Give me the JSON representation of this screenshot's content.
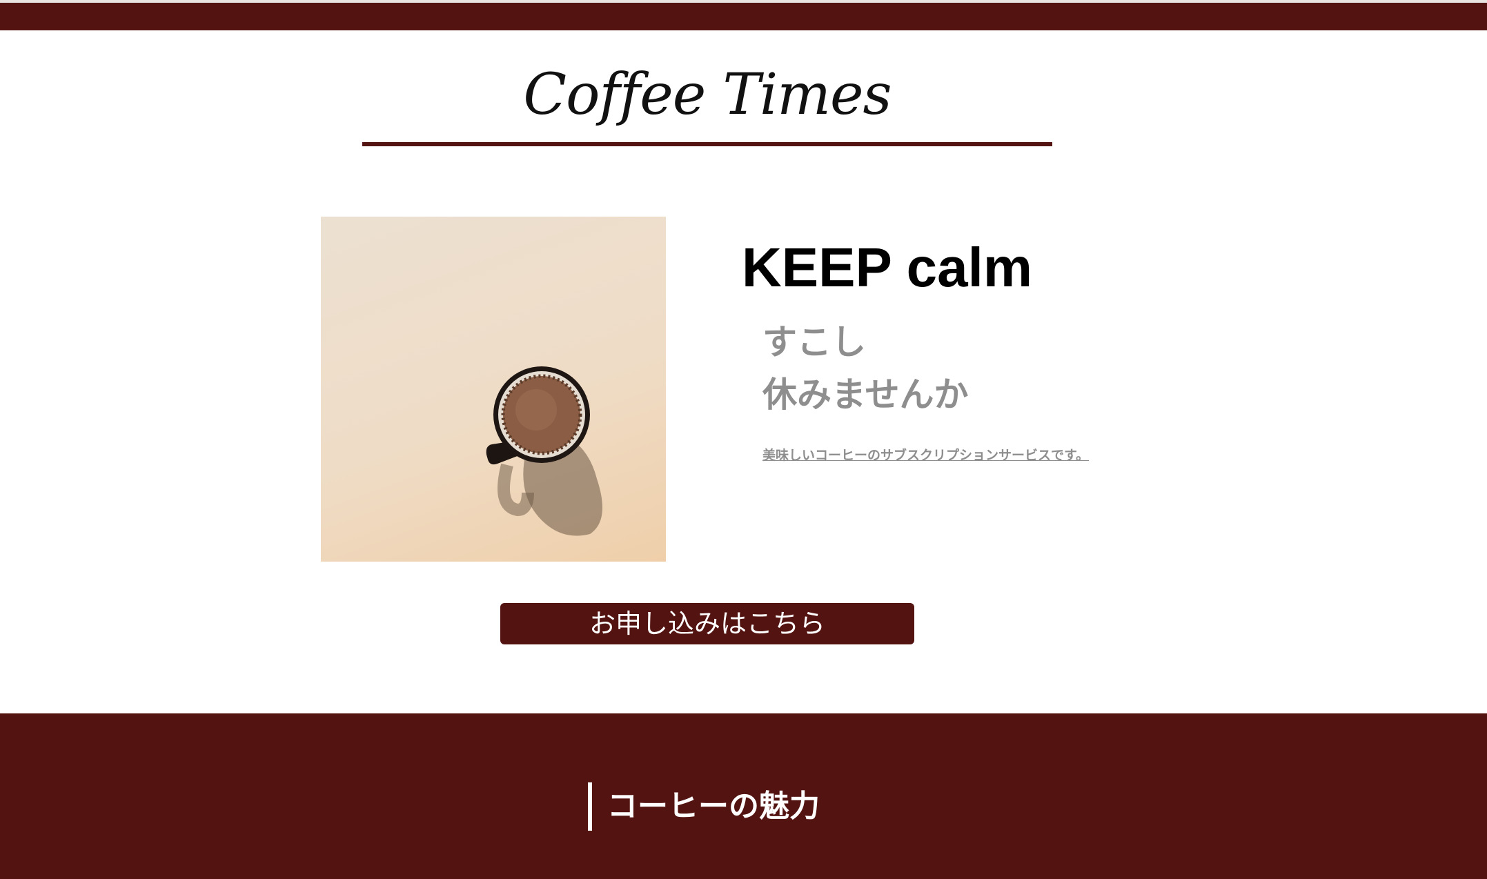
{
  "header": {
    "site_title": "Coffee Times"
  },
  "hero": {
    "image_alt": "coffee-mug-top-view",
    "headline": "KEEP calm",
    "subline_1": "すこし",
    "subline_2": "休みませんか",
    "description": "美味しいコーヒーのサブスクリプションサービスです。"
  },
  "cta": {
    "label": "お申し込みはこちら"
  },
  "section": {
    "title": "コーヒーの魅力"
  },
  "colors": {
    "brand": "#531311",
    "muted_text": "#8e8e8e",
    "background": "#ffffff"
  }
}
